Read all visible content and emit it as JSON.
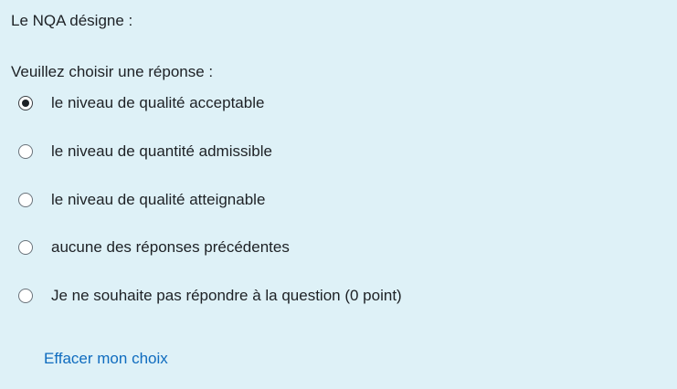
{
  "question": {
    "text": "Le NQA désigne :",
    "prompt": "Veuillez choisir une réponse :"
  },
  "answers": [
    {
      "label": "le niveau de qualité acceptable",
      "selected": true
    },
    {
      "label": "le niveau de quantité admissible",
      "selected": false
    },
    {
      "label": "le niveau de qualité atteignable",
      "selected": false
    },
    {
      "label": "aucune des réponses précédentes",
      "selected": false
    },
    {
      "label": "Je ne souhaite pas répondre à la question (0 point)",
      "selected": false
    }
  ],
  "actions": {
    "clear_label": "Effacer mon choix"
  },
  "colors": {
    "background": "#def1f7",
    "text": "#1d2125",
    "link": "#0f6cbf"
  }
}
